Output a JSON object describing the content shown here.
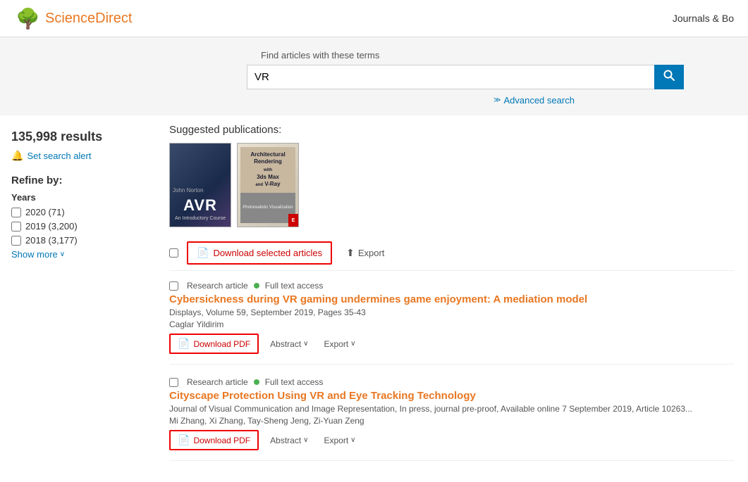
{
  "header": {
    "logo_text": "ScienceDirect",
    "nav_text": "Journals & Bo"
  },
  "search": {
    "label": "Find articles with these terms",
    "value": "VR",
    "placeholder": "",
    "button_icon": "🔍",
    "advanced_label": "Advanced search"
  },
  "sidebar": {
    "results_count": "135,998 results",
    "set_alert_label": "Set search alert",
    "refine_label": "Refine by:",
    "years_label": "Years",
    "filters": [
      {
        "label": "2020 (71)",
        "checked": false
      },
      {
        "label": "2019 (3,200)",
        "checked": false
      },
      {
        "label": "2018 (3,177)",
        "checked": false
      }
    ],
    "show_more_label": "Show more"
  },
  "content": {
    "suggested_label": "Suggested publications:",
    "books": [
      {
        "title": "AVR",
        "subtitle": "An Introductory Course",
        "type": "avr"
      },
      {
        "title": "Architectural Rendering with 3ds Max and V-Ray",
        "subtitle": "Photorealistic Visualization",
        "type": "arch"
      }
    ],
    "toolbar": {
      "download_selected_label": "Download selected articles",
      "export_label": "Export"
    },
    "articles": [
      {
        "id": 1,
        "type": "Research article",
        "access": "Full text access",
        "title": "Cybersickness during VR gaming undermines game enjoyment: A mediation model",
        "journal": "Displays, Volume 59, September 2019, Pages 35-43",
        "authors": "Caglar Yildirim",
        "download_label": "Download PDF",
        "abstract_label": "Abstract",
        "export_label": "Export"
      },
      {
        "id": 2,
        "type": "Research article",
        "access": "Full text access",
        "title": "Cityscape Protection Using VR and Eye Tracking Technology",
        "journal": "Journal of Visual Communication and Image Representation, In press, journal pre-proof, Available online 7 September 2019, Article 10263...",
        "authors": "Mi Zhang, Xi Zhang, Tay-Sheng Jeng, Zi-Yuan Zeng",
        "download_label": "Download PDF",
        "abstract_label": "Abstract",
        "export_label": "Export"
      }
    ]
  }
}
